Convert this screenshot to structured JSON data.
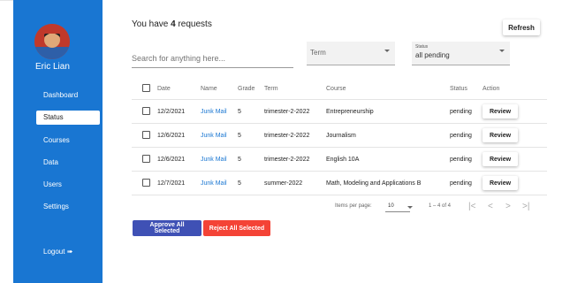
{
  "sidebar": {
    "user_name": "Eric Lian",
    "items": [
      {
        "label": "Dashboard",
        "active": false
      },
      {
        "label": "Status",
        "active": true
      },
      {
        "label": "Courses",
        "active": false
      },
      {
        "label": "Data",
        "active": false
      },
      {
        "label": "Users",
        "active": false
      },
      {
        "label": "Settings",
        "active": false
      }
    ],
    "logout_label": "Logout ➠"
  },
  "header": {
    "prefix": "You have ",
    "count": "4",
    "suffix": " requests",
    "refresh_label": "Refresh"
  },
  "filters": {
    "search_placeholder": "Search for anything here...",
    "term_label": "Term",
    "status_label": "Status",
    "status_value": "all pending"
  },
  "table": {
    "columns": [
      "Date",
      "Name",
      "Grade",
      "Term",
      "Course",
      "Status",
      "Action"
    ],
    "rows": [
      {
        "date": "12/2/2021",
        "name": "Junk Mail",
        "grade": "5",
        "term": "trimester-2-2022",
        "course": "Entrepreneurship",
        "status": "pending",
        "action": "Review"
      },
      {
        "date": "12/6/2021",
        "name": "Junk Mail",
        "grade": "5",
        "term": "trimester-2-2022",
        "course": "Journalism",
        "status": "pending",
        "action": "Review"
      },
      {
        "date": "12/6/2021",
        "name": "Junk Mail",
        "grade": "5",
        "term": "trimester-2-2022",
        "course": "English 10A",
        "status": "pending",
        "action": "Review"
      },
      {
        "date": "12/7/2021",
        "name": "Junk Mail",
        "grade": "5",
        "term": "summer-2022",
        "course": "Math, Modeling and Applications B",
        "status": "pending",
        "action": "Review"
      }
    ]
  },
  "pagination": {
    "items_per_page_label": "Items per page:",
    "items_per_page_value": "10",
    "range": "1 – 4 of 4"
  },
  "actions": {
    "approve_label": "Approve All Selected",
    "reject_label": "Reject All Selected"
  },
  "colors": {
    "sidebar": "#1976d2",
    "approve": "#3f51b5",
    "reject": "#f44336",
    "link": "#1976d2"
  }
}
